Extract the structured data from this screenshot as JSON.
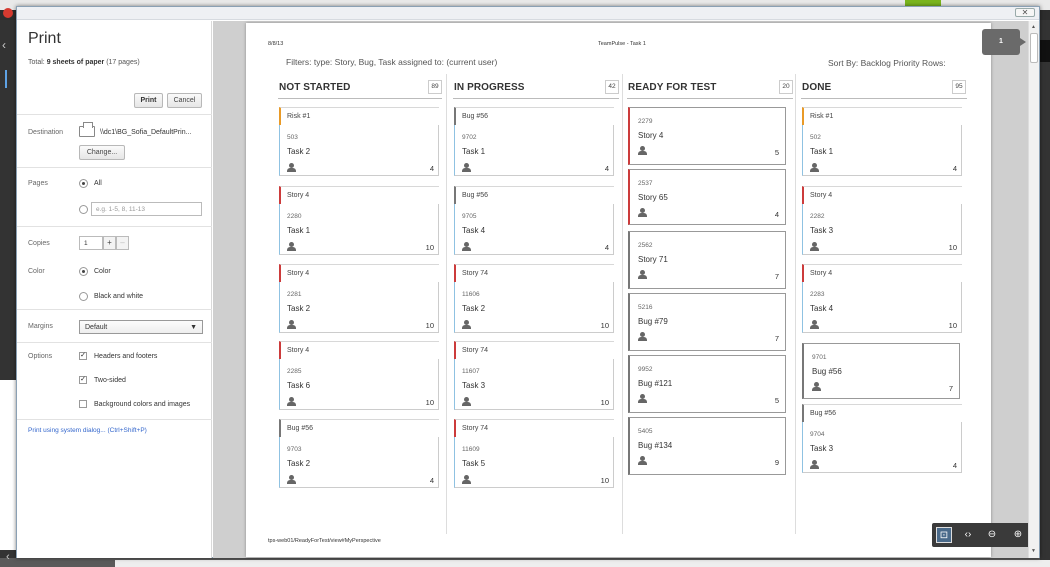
{
  "settings": {
    "title": "Print",
    "total_prefix": "Total: ",
    "total_bold": "9 sheets of paper",
    "total_suffix": " (17 pages)",
    "print_label": "Print",
    "cancel_label": "Cancel",
    "destination_label": "Destination",
    "destination_value": "\\\\dc1\\BG_Sofia_DefaultPrin...",
    "change_label": "Change...",
    "pages_label": "Pages",
    "pages_all": "All",
    "pages_placeholder": "e.g. 1-5, 8, 11-13",
    "copies_label": "Copies",
    "copies_value": "1",
    "copies_plus": "+",
    "copies_minus": "–",
    "color_label": "Color",
    "color_option": "Color",
    "bw_option": "Black and white",
    "margins_label": "Margins",
    "margins_value": "Default",
    "options_label": "Options",
    "opt_headers": "Headers and footers",
    "opt_twosided": "Two-sided",
    "opt_background": "Background colors and images",
    "system_dialog_link": "Print using system dialog... (Ctrl+Shift+P)"
  },
  "page": {
    "date": "8/8/13",
    "title": "TeamPulse - Task 1",
    "filters": "Filters: type: Story, Bug, Task   assigned to: (current user)",
    "sort": "Sort By: Backlog Priority   Rows:",
    "footer": "tps-web01/ReadyForTest/view#MyPerspective",
    "page_number": "1"
  },
  "board": {
    "not_started": {
      "title": "NOT STARTED",
      "count": "89",
      "cards": [
        {
          "parent": "Risk #1",
          "id": "503",
          "name": "Task 2",
          "points": "4",
          "parent_color": "#e99a27"
        },
        {
          "parent": "Story 4",
          "id": "2280",
          "name": "Task 1",
          "points": "10",
          "parent_color": "#cc3b3b"
        },
        {
          "parent": "Story 4",
          "id": "2281",
          "name": "Task 2",
          "points": "10",
          "parent_color": "#cc3b3b"
        },
        {
          "parent": "Story 4",
          "id": "2285",
          "name": "Task 6",
          "points": "10",
          "parent_color": "#cc3b3b"
        },
        {
          "parent": "Bug #56",
          "id": "9703",
          "name": "Task 2",
          "points": "4",
          "parent_color": "#777777"
        }
      ]
    },
    "in_progress": {
      "title": "IN PROGRESS",
      "count": "42",
      "cards": [
        {
          "parent": "Bug #56",
          "id": "9702",
          "name": "Task 1",
          "points": "4",
          "parent_color": "#777777"
        },
        {
          "parent": "Bug #56",
          "id": "9705",
          "name": "Task 4",
          "points": "4",
          "parent_color": "#777777"
        },
        {
          "parent": "Story 74",
          "id": "11606",
          "name": "Task 2",
          "points": "10",
          "parent_color": "#cc3b3b"
        },
        {
          "parent": "Story 74",
          "id": "11607",
          "name": "Task 3",
          "points": "10",
          "parent_color": "#cc3b3b"
        },
        {
          "parent": "Story 74",
          "id": "11609",
          "name": "Task 5",
          "points": "10",
          "parent_color": "#cc3b3b"
        }
      ]
    },
    "ready_for_test": {
      "title": "READY FOR TEST",
      "count": "20",
      "cards": [
        {
          "id": "2279",
          "name": "Story 4",
          "points": "5"
        },
        {
          "id": "2537",
          "name": "Story 65",
          "points": "4"
        },
        {
          "id": "2562",
          "name": "Story 71",
          "points": "7"
        },
        {
          "id": "5216",
          "name": "Bug #79",
          "points": "7"
        },
        {
          "id": "9952",
          "name": "Bug #121",
          "points": "5"
        },
        {
          "id": "5405",
          "name": "Bug #134",
          "points": "9"
        }
      ]
    },
    "done": {
      "title": "DONE",
      "count": "95",
      "cards": [
        {
          "parent": "Risk #1",
          "id": "502",
          "name": "Task 1",
          "points": "4",
          "parent_color": "#e99a27"
        },
        {
          "parent": "Story 4",
          "id": "2282",
          "name": "Task 3",
          "points": "10",
          "parent_color": "#cc3b3b"
        },
        {
          "parent": "Story 4",
          "id": "2283",
          "name": "Task 4",
          "points": "10",
          "parent_color": "#cc3b3b"
        },
        {
          "parent": "",
          "id": "9701",
          "name": "Bug #56",
          "points": "7",
          "parent_color": ""
        },
        {
          "parent": "Bug #56",
          "id": "9704",
          "name": "Task 3",
          "points": "4",
          "parent_color": "#777777"
        }
      ]
    }
  },
  "colors": {
    "risk": "#e99a27",
    "story": "#cc3b3b",
    "bug": "#777777",
    "task_child": "#8fc2e2",
    "link": "#3366cc"
  }
}
